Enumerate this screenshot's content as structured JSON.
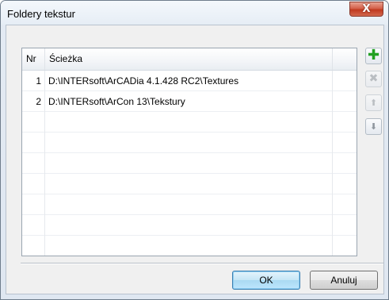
{
  "window": {
    "title": "Foldery tekstur",
    "close_glyph": "X"
  },
  "grid": {
    "columns": [
      {
        "key": "nr",
        "label": "Nr"
      },
      {
        "key": "path",
        "label": "Ścieżka"
      }
    ],
    "rows": [
      {
        "nr": "1",
        "path": "D:\\INTERsoft\\ArCADia 4.1.428 RC2\\Textures"
      },
      {
        "nr": "2",
        "path": "D:\\INTERsoft\\ArCon 13\\Tekstury"
      }
    ],
    "empty_rows": 7
  },
  "side_buttons": [
    {
      "name": "add-icon",
      "glyph": "✚",
      "enabled": true
    },
    {
      "name": "delete-icon",
      "glyph": "✖",
      "enabled": false
    },
    {
      "name": "move-up-icon",
      "glyph": "⬆",
      "enabled": false
    },
    {
      "name": "move-down-icon",
      "glyph": "⬇",
      "enabled": true
    }
  ],
  "buttons": {
    "ok": "OK",
    "cancel": "Anuluj"
  }
}
